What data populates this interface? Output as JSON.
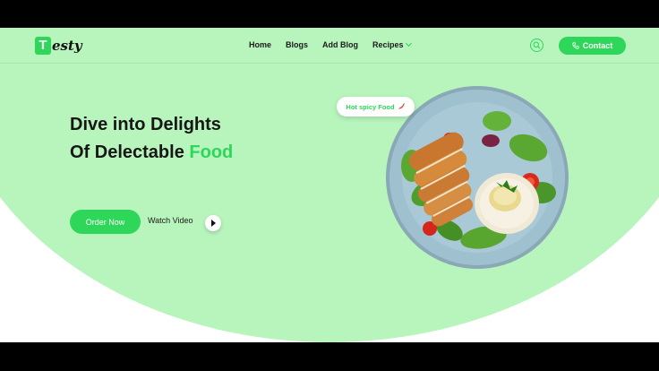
{
  "brand": {
    "mark_letter": "T",
    "name": "esty"
  },
  "nav": {
    "items": [
      "Home",
      "Blogs",
      "Add Blog",
      "Recipes"
    ],
    "contact_label": "Contact"
  },
  "hero": {
    "headline_line1": "Dive into Delights",
    "headline_line2_prefix": "Of Delectable ",
    "headline_line2_accent": "Food",
    "order_button": "Order Now",
    "watch_label": "Watch Video",
    "badge_text": "Hot spicy Food"
  },
  "colors": {
    "accent": "#2ed65a",
    "hero_bg": "#b7f5bd",
    "text": "#161616"
  },
  "icons": [
    "search-icon",
    "phone-icon",
    "play-icon",
    "chevron-down-icon",
    "chili-icon"
  ]
}
